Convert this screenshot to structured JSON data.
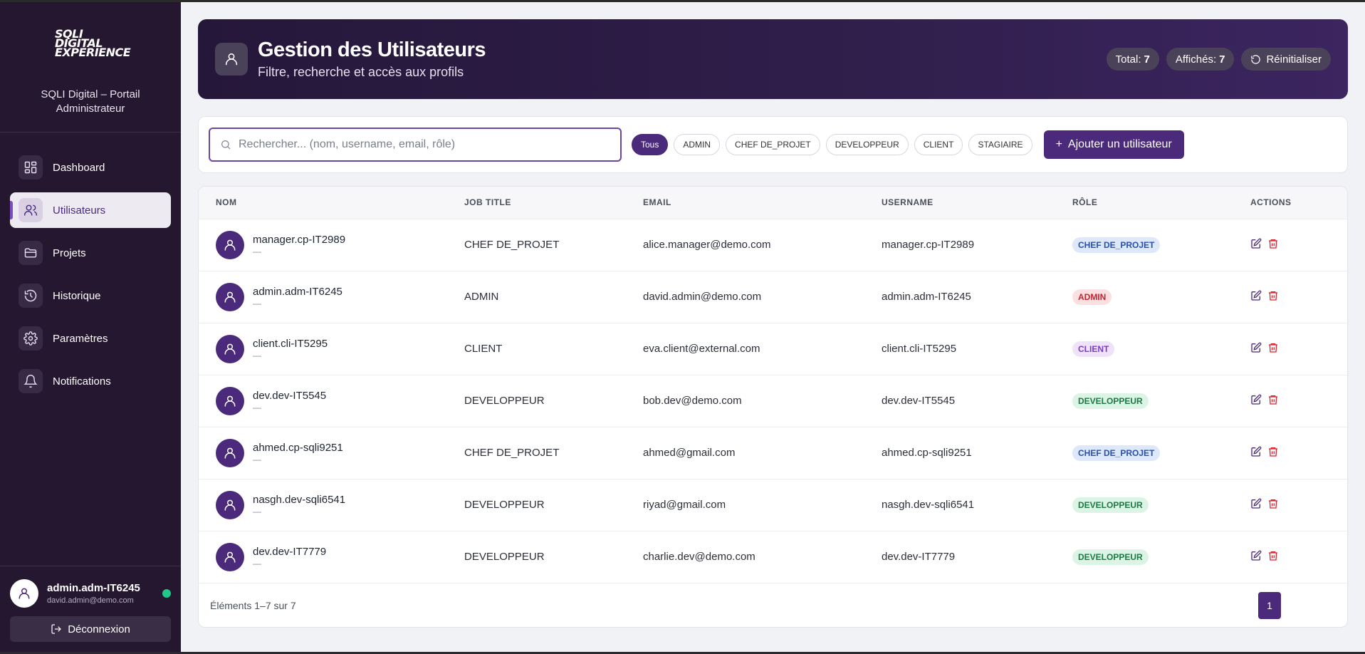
{
  "sidebar": {
    "logo_lines": [
      "SQLI",
      "DIGITAL",
      "EXPERIENCE"
    ],
    "portal_name": "SQLI Digital – Portail Administrateur",
    "items": [
      {
        "label": "Dashboard",
        "icon": "dashboard-icon"
      },
      {
        "label": "Utilisateurs",
        "icon": "users-icon",
        "active": true
      },
      {
        "label": "Projets",
        "icon": "folder-icon"
      },
      {
        "label": "Historique",
        "icon": "history-icon"
      },
      {
        "label": "Paramètres",
        "icon": "gear-icon"
      },
      {
        "label": "Notifications",
        "icon": "bell-icon"
      }
    ],
    "user": {
      "name": "admin.adm-IT6245",
      "email": "david.admin@demo.com",
      "status": "online"
    },
    "logout_label": "Déconnexion"
  },
  "header": {
    "title": "Gestion des Utilisateurs",
    "subtitle": "Filtre, recherche et accès aux profils",
    "total_label": "Total:",
    "total_value": "7",
    "shown_label": "Affichés:",
    "shown_value": "7",
    "reset_label": "Réinitialiser"
  },
  "toolbar": {
    "search_placeholder": "Rechercher... (nom, username, email, rôle)",
    "filters": [
      "Tous",
      "ADMIN",
      "CHEF DE_PROJET",
      "DEVELOPPEUR",
      "CLIENT",
      "STAGIAIRE"
    ],
    "active_filter": "Tous",
    "add_label": "Ajouter un utilisateur"
  },
  "table": {
    "columns": [
      "NOM",
      "JOB TITLE",
      "EMAIL",
      "USERNAME",
      "RÔLE",
      "ACTIONS"
    ],
    "rows": [
      {
        "name": "manager.cp-IT2989",
        "sub": "—",
        "job": "CHEF DE_PROJET",
        "email": "alice.manager@demo.com",
        "username": "manager.cp-IT2989",
        "role": "CHEF DE_PROJET",
        "role_key": "CHEF_DE_PROJET"
      },
      {
        "name": "admin.adm-IT6245",
        "sub": "—",
        "job": "ADMIN",
        "email": "david.admin@demo.com",
        "username": "admin.adm-IT6245",
        "role": "ADMIN",
        "role_key": "ADMIN"
      },
      {
        "name": "client.cli-IT5295",
        "sub": "—",
        "job": "CLIENT",
        "email": "eva.client@external.com",
        "username": "client.cli-IT5295",
        "role": "CLIENT",
        "role_key": "CLIENT"
      },
      {
        "name": "dev.dev-IT5545",
        "sub": "—",
        "job": "DEVELOPPEUR",
        "email": "bob.dev@demo.com",
        "username": "dev.dev-IT5545",
        "role": "DEVELOPPEUR",
        "role_key": "DEVELOPPEUR"
      },
      {
        "name": "ahmed.cp-sqli9251",
        "sub": "—",
        "job": "CHEF DE_PROJET",
        "email": "ahmed@gmail.com",
        "username": "ahmed.cp-sqli9251",
        "role": "CHEF DE_PROJET",
        "role_key": "CHEF_DE_PROJET"
      },
      {
        "name": "nasgh.dev-sqli6541",
        "sub": "—",
        "job": "DEVELOPPEUR",
        "email": "riyad@gmail.com",
        "username": "nasgh.dev-sqli6541",
        "role": "DEVELOPPEUR",
        "role_key": "DEVELOPPEUR"
      },
      {
        "name": "dev.dev-IT7779",
        "sub": "—",
        "job": "DEVELOPPEUR",
        "email": "charlie.dev@demo.com",
        "username": "dev.dev-IT7779",
        "role": "DEVELOPPEUR",
        "role_key": "DEVELOPPEUR"
      }
    ],
    "footer_text": "Éléments 1–7 sur 7",
    "current_page": "1"
  },
  "colors": {
    "sidebar_bg": "#24172f",
    "accent": "#4b2a7c",
    "online": "#22c58a",
    "delete": "#d8232d"
  }
}
